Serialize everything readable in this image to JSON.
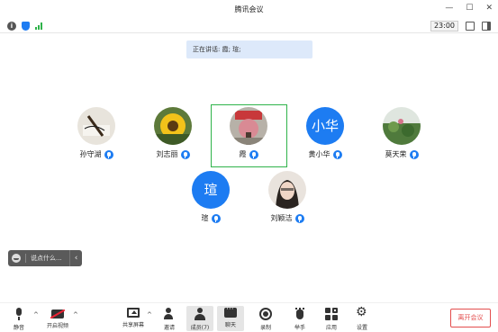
{
  "window": {
    "title": "腾讯会议"
  },
  "infobar": {
    "timer": "23:00"
  },
  "speaking": {
    "text": "正在讲话: 霞; 瑄;"
  },
  "members": [
    {
      "name": "孙守湖",
      "initials": "",
      "photo": "calligraphy"
    },
    {
      "name": "刘志丽",
      "initials": "",
      "photo": "sunflower"
    },
    {
      "name": "霞",
      "initials": "",
      "photo": "pink-tree"
    },
    {
      "name": "黄小华",
      "initials": "小华",
      "photo": ""
    },
    {
      "name": "莫天荣",
      "initials": "",
      "photo": "lotus"
    },
    {
      "name": "瑄",
      "initials": "瑄",
      "photo": ""
    },
    {
      "name": "刘颖洁",
      "initials": "",
      "photo": "woman-portrait"
    }
  ],
  "chat_input": {
    "placeholder": "说点什么..."
  },
  "toolbar": {
    "mute": "静音",
    "video": "开启视频",
    "share": "共享屏幕",
    "invite": "邀请",
    "members": "成员(7)",
    "chat": "聊天",
    "record": "录制",
    "hand": "举手",
    "apps": "应用",
    "settings": "设置"
  },
  "leave": "离开会议",
  "colors": {
    "accent": "#1d7cf2",
    "active_speaker_border": "#2fb34a",
    "leave_red": "#e34d4d"
  }
}
